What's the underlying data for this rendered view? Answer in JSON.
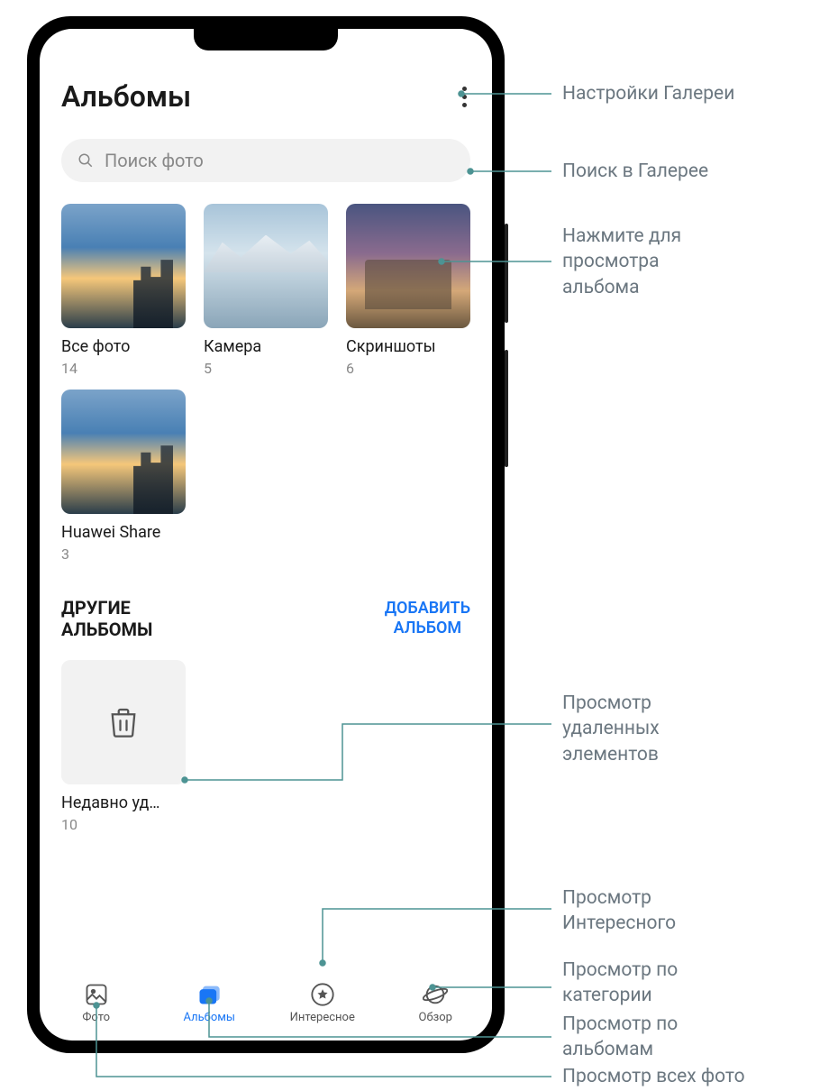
{
  "header": {
    "title": "Альбомы"
  },
  "search": {
    "placeholder": "Поиск фото"
  },
  "albums": [
    {
      "name": "Все фото",
      "count": "14",
      "thumb": "city"
    },
    {
      "name": "Камера",
      "count": "5",
      "thumb": "mountain"
    },
    {
      "name": "Скриншоты",
      "count": "6",
      "thumb": "colosseum"
    },
    {
      "name": "Huawei Share",
      "count": "3",
      "thumb": "city"
    }
  ],
  "other_section": {
    "title_line1": "ДРУГИЕ",
    "title_line2": "АЛЬБОМЫ",
    "add_line1": "ДОБАВИТЬ",
    "add_line2": "АЛЬБОМ"
  },
  "other_albums": [
    {
      "name": "Недавно уд…",
      "count": "10",
      "type": "trash"
    }
  ],
  "nav": [
    {
      "label": "Фото",
      "active": false
    },
    {
      "label": "Альбомы",
      "active": true
    },
    {
      "label": "Интересное",
      "active": false
    },
    {
      "label": "Обзор",
      "active": false
    }
  ],
  "annotations": {
    "settings": "Настройки Галереи",
    "search": "Поиск в Галерее",
    "view_album_l1": "Нажмите для",
    "view_album_l2": "просмотра",
    "view_album_l3": "альбома",
    "deleted_l1": "Просмотр",
    "deleted_l2": "удаленных",
    "deleted_l3": "элементов",
    "highlights_l1": "Просмотр",
    "highlights_l2": "Интересного",
    "bycat_l1": "Просмотр по",
    "bycat_l2": "категории",
    "byalbum_l1": "Просмотр по",
    "byalbum_l2": "альбомам",
    "allphotos": "Просмотр всех фото"
  }
}
